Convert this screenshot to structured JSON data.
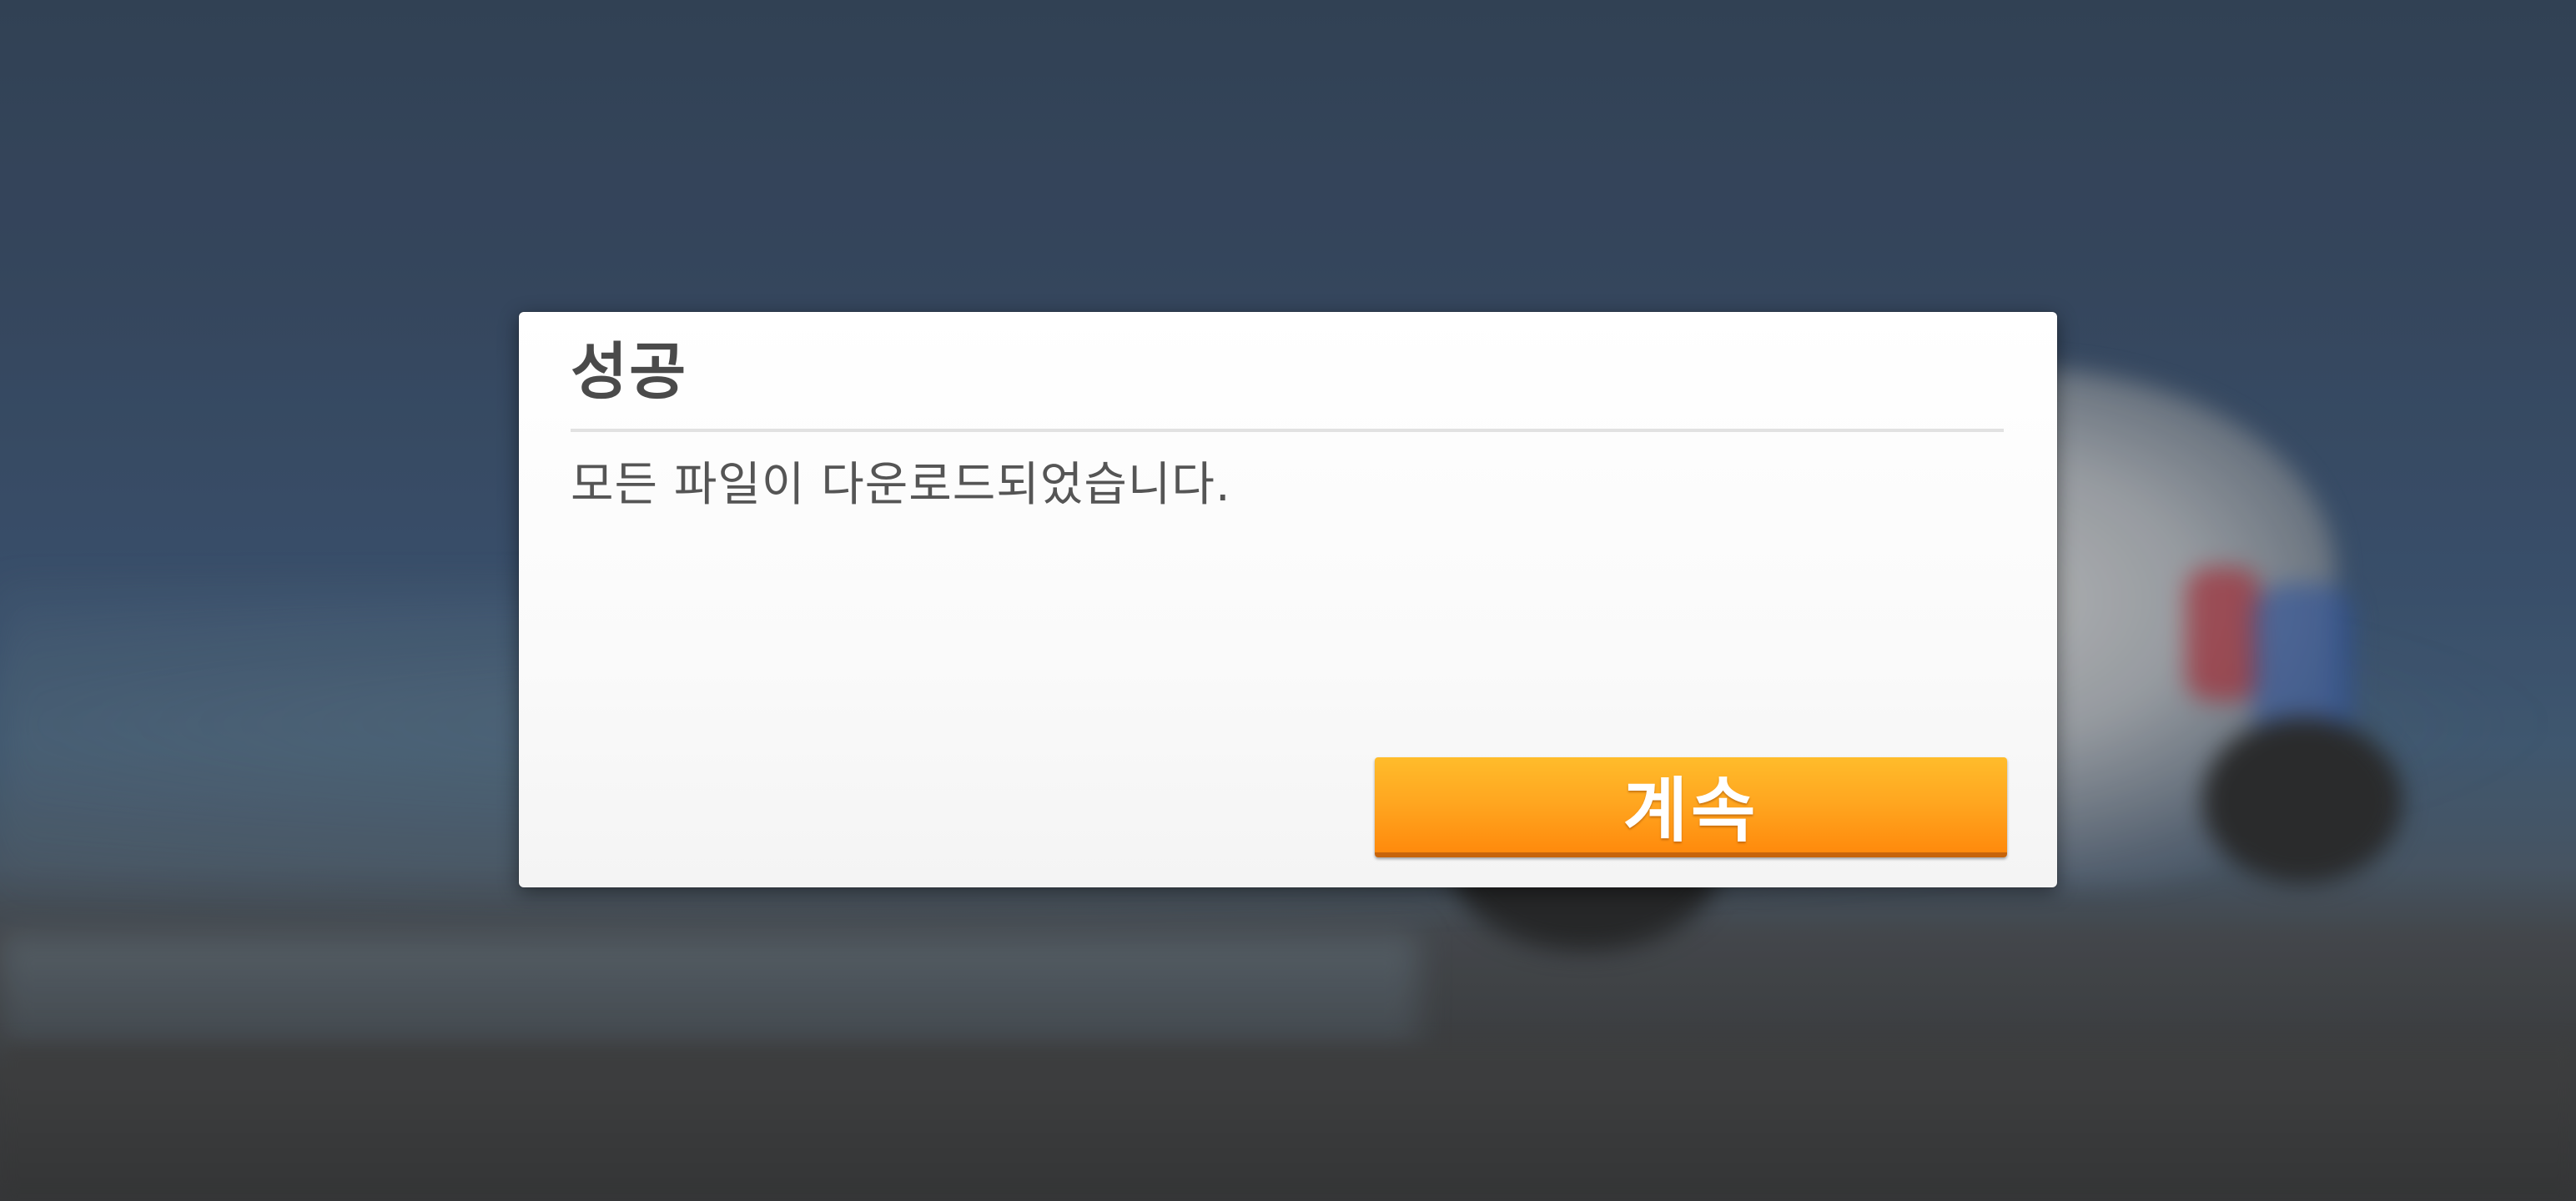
{
  "dialog": {
    "title": "성공",
    "message": "모든 파일이 다운로드되었습니다.",
    "continue_label": "계속"
  },
  "colors": {
    "button_top": "#ffbc2b",
    "button_bottom": "#ff8a0c",
    "title_text": "#4a4a4a",
    "dialog_bg": "#fafafa"
  }
}
